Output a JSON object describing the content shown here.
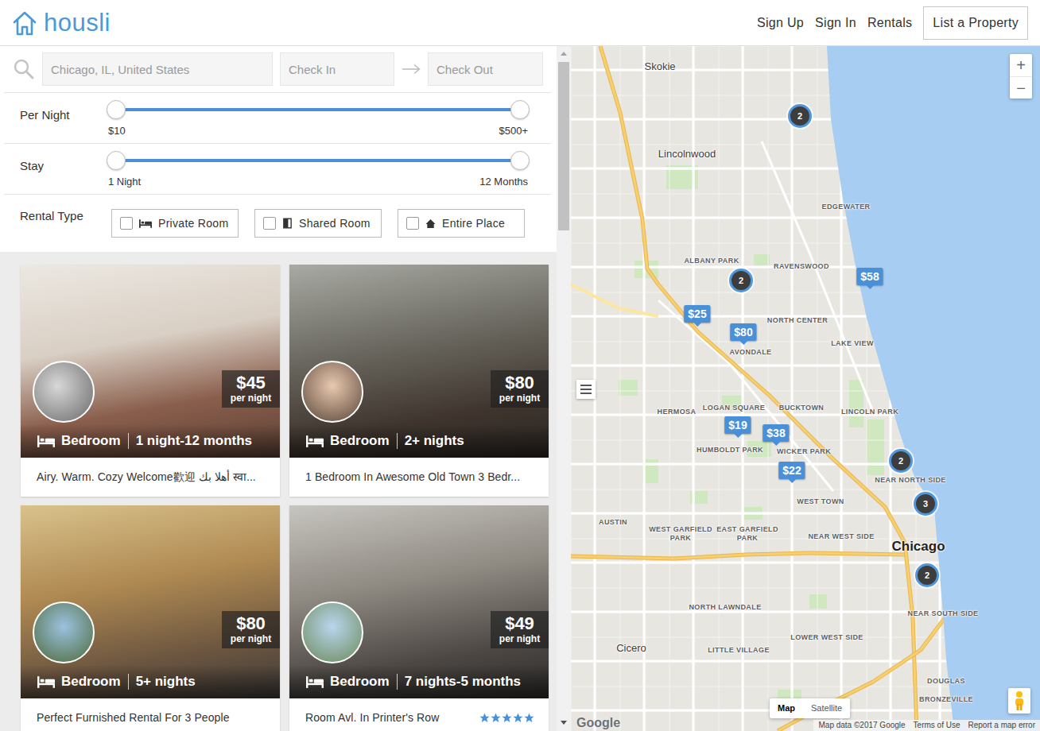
{
  "header": {
    "logo": "housli",
    "nav": [
      {
        "label": "Sign Up"
      },
      {
        "label": "Sign In"
      },
      {
        "label": "Rentals"
      }
    ],
    "cta": "List a Property"
  },
  "search": {
    "location_placeholder": "Chicago, IL, United States",
    "check_in_placeholder": "Check In",
    "check_out_placeholder": "Check Out"
  },
  "sliders": [
    {
      "label": "Per Night",
      "min_label": "$10",
      "max_label": "$500+",
      "low": 0,
      "high": 1
    },
    {
      "label": "Stay",
      "min_label": "1 Night",
      "max_label": "12 Months",
      "low": 0,
      "high": 1
    }
  ],
  "rental_type": {
    "label": "Rental Type",
    "options": [
      {
        "label": "Private Room",
        "checked": false
      },
      {
        "label": "Shared Room",
        "checked": false
      },
      {
        "label": "Entire Place",
        "checked": false
      }
    ]
  },
  "listings": [
    {
      "price": "$45",
      "price_unit": "per night",
      "room_type": "Bedroom",
      "stay": "1 night-12 months",
      "title": "Airy. Warm. Cozy Welcome歡迎 أهلا بك स्वा..."
    },
    {
      "price": "$80",
      "price_unit": "per night",
      "room_type": "Bedroom",
      "stay": "2+ nights",
      "title": "1 Bedroom In Awesome Old Town 3 Bedr..."
    },
    {
      "price": "$80",
      "price_unit": "per night",
      "room_type": "Bedroom",
      "stay": "5+ nights",
      "title": "Perfect Furnished Rental For 3 People"
    },
    {
      "price": "$49",
      "price_unit": "per night",
      "room_type": "Bedroom",
      "stay": "7 nights-5 months",
      "title": "Room Avl. In Printer's Row",
      "stars": 5
    }
  ],
  "map": {
    "labels": [
      {
        "text": "Skokie",
        "kind": "city"
      },
      {
        "text": "Lincolnwood",
        "kind": "city"
      },
      {
        "text": "EDGEWATER",
        "kind": "area"
      },
      {
        "text": "ALBANY PARK",
        "kind": "area"
      },
      {
        "text": "RAVENSWOOD",
        "kind": "area"
      },
      {
        "text": "NORTH CENTER",
        "kind": "area"
      },
      {
        "text": "AVONDALE",
        "kind": "area"
      },
      {
        "text": "LAKE VIEW",
        "kind": "area"
      },
      {
        "text": "HERMOSA",
        "kind": "area"
      },
      {
        "text": "LOGAN SQUARE",
        "kind": "area"
      },
      {
        "text": "BUCKTOWN",
        "kind": "area"
      },
      {
        "text": "LINCOLN PARK",
        "kind": "area"
      },
      {
        "text": "HUMBOLDT PARK",
        "kind": "area"
      },
      {
        "text": "WICKER PARK",
        "kind": "area"
      },
      {
        "text": "NEAR NORTH SIDE",
        "kind": "area"
      },
      {
        "text": "AUSTIN",
        "kind": "area"
      },
      {
        "text": "WEST TOWN",
        "kind": "area"
      },
      {
        "text": "WEST GARFIELD PARK",
        "kind": "area"
      },
      {
        "text": "EAST GARFIELD PARK",
        "kind": "area"
      },
      {
        "text": "NEAR WEST SIDE",
        "kind": "area"
      },
      {
        "text": "Chicago",
        "kind": "major"
      },
      {
        "text": "NORTH LAWNDALE",
        "kind": "area"
      },
      {
        "text": "NEAR SOUTH SIDE",
        "kind": "area"
      },
      {
        "text": "Cicero",
        "kind": "city"
      },
      {
        "text": "LITTLE VILLAGE",
        "kind": "area"
      },
      {
        "text": "LOWER WEST SIDE",
        "kind": "area"
      },
      {
        "text": "DOUGLAS",
        "kind": "area"
      },
      {
        "text": "BRONZEVILLE",
        "kind": "area"
      }
    ],
    "markers": [
      {
        "kind": "cluster",
        "text": "2"
      },
      {
        "kind": "cluster",
        "text": "2"
      },
      {
        "kind": "price",
        "text": "$58"
      },
      {
        "kind": "price",
        "text": "$25"
      },
      {
        "kind": "price",
        "text": "$80"
      },
      {
        "kind": "price",
        "text": "$19"
      },
      {
        "kind": "price",
        "text": "$38"
      },
      {
        "kind": "price",
        "text": "$22"
      },
      {
        "kind": "cluster",
        "text": "2"
      },
      {
        "kind": "cluster",
        "text": "3"
      },
      {
        "kind": "cluster",
        "text": "2"
      }
    ],
    "zoom": [
      "+",
      "−"
    ],
    "map_types": [
      {
        "label": "Map",
        "selected": true
      },
      {
        "label": "Satellite",
        "selected": false
      }
    ],
    "logo": "Google",
    "attribution": [
      "Map data ©2017 Google",
      "Terms of Use",
      "Report a map error"
    ]
  }
}
